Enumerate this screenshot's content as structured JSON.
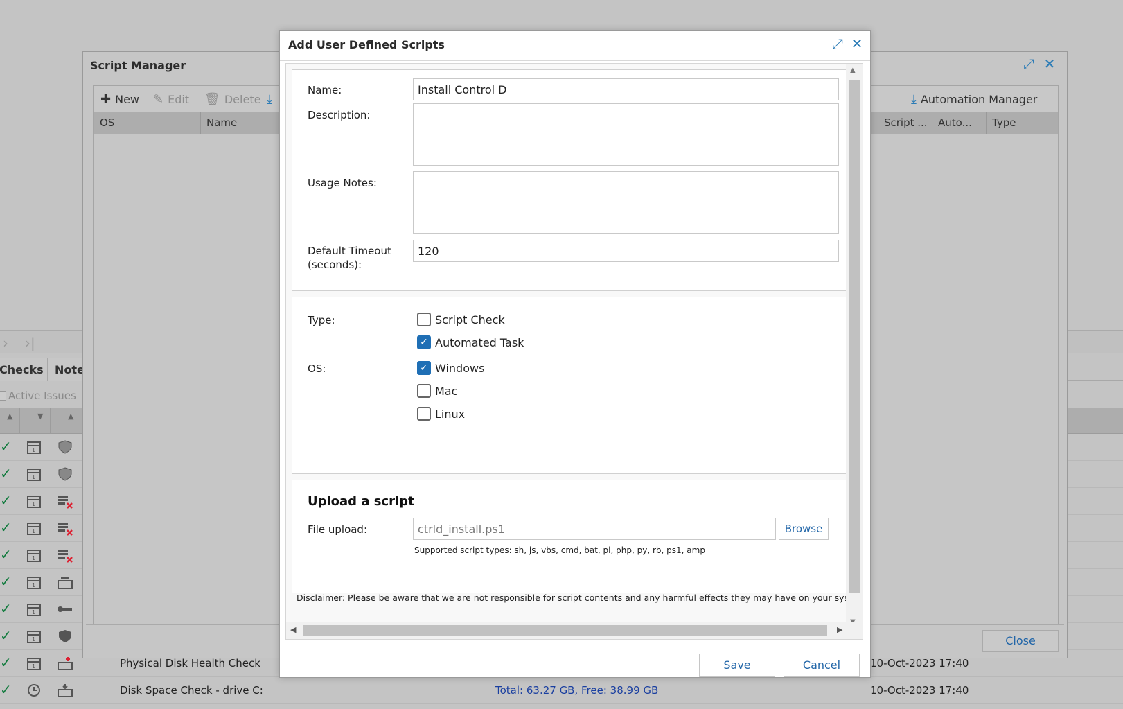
{
  "background": {
    "tabs": [
      "Checks",
      "Note"
    ],
    "filter_label": "Active Issues",
    "rows": [
      {
        "name": "Physical Disk Health Check",
        "value": "",
        "date": "10-Oct-2023 17:40"
      },
      {
        "name": "Disk Space Check - drive C:",
        "value": "Total: 63.27 GB, Free: 38.99 GB",
        "date": "10-Oct-2023 17:40"
      }
    ]
  },
  "script_manager": {
    "title": "Script Manager",
    "toolbar": {
      "new_label": "New",
      "edit_label": "Edit",
      "delete_label": "Delete",
      "automation_manager_label": "Automation Manager"
    },
    "columns": {
      "os": "OS",
      "name": "Name",
      "script": "Script ...",
      "auto": "Auto...",
      "type": "Type"
    },
    "close_label": "Close"
  },
  "dialog": {
    "title": "Add User Defined Scripts",
    "fields": {
      "name_label": "Name:",
      "name_value": "Install Control D",
      "description_label": "Description:",
      "description_value": "",
      "usage_label": "Usage Notes:",
      "usage_value": "",
      "timeout_label_1": "Default Timeout",
      "timeout_label_2": "(seconds):",
      "timeout_value": "120"
    },
    "type": {
      "label": "Type:",
      "options": [
        {
          "label": "Script Check",
          "checked": false
        },
        {
          "label": "Automated Task",
          "checked": true
        }
      ]
    },
    "os": {
      "label": "OS:",
      "options": [
        {
          "label": "Windows",
          "checked": true
        },
        {
          "label": "Mac",
          "checked": false
        },
        {
          "label": "Linux",
          "checked": false
        }
      ]
    },
    "upload": {
      "title": "Upload a script",
      "file_label": "File upload:",
      "file_value": "ctrld_install.ps1",
      "browse_label": "Browse",
      "supported": "Supported script types: sh, js, vbs, cmd, bat, pl, php, py, rb, ps1, amp"
    },
    "disclaimer": "Disclaimer: Please be aware that we are not responsible for script contents and any harmful effects they may have on your systems.",
    "save_label": "Save",
    "cancel_label": "Cancel"
  },
  "colors": {
    "accent": "#2266a8",
    "checkbox_on": "#1f6fb5",
    "status_ok": "#0f7a3c"
  }
}
